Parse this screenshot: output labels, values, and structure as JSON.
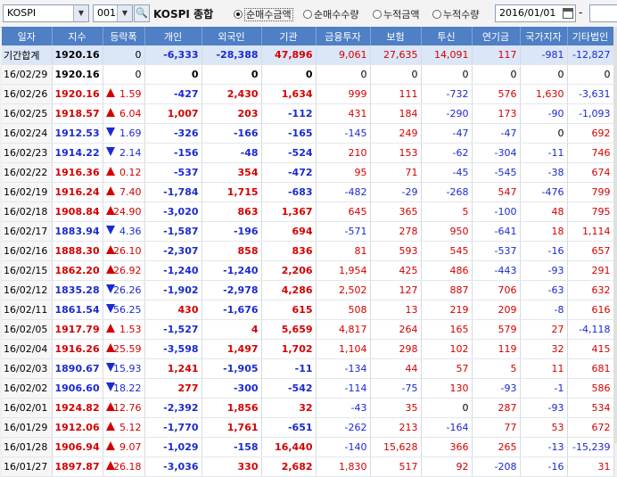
{
  "toolbar": {
    "market": "KOSPI",
    "code": "001",
    "title": "KOSPI 종합",
    "radios": [
      "순매수금액",
      "순매수수량",
      "누적금액",
      "누적수량"
    ],
    "start_date": "2016/01/01",
    "dash": "-"
  },
  "columns": [
    "일자",
    "지수",
    "등락폭",
    "개인",
    "외국인",
    "기관",
    "금융투자",
    "보험",
    "투신",
    "연기금",
    "국가지자",
    "기타법인"
  ],
  "rows": [
    [
      "기간합계",
      "1920.16",
      "0",
      "-6,333",
      "-28,388",
      "47,896",
      "9,061",
      "27,635",
      "14,091",
      "117",
      "-981",
      "-12,827"
    ],
    [
      "16/02/29",
      "1920.16",
      "0",
      "0",
      "0",
      "0",
      "0",
      "0",
      "0",
      "0",
      "0",
      "0"
    ],
    [
      "16/02/26",
      "1920.16",
      "1.59",
      "-427",
      "2,430",
      "1,634",
      "999",
      "111",
      "-732",
      "576",
      "1,630",
      "-3,631"
    ],
    [
      "16/02/25",
      "1918.57",
      "6.04",
      "1,007",
      "203",
      "-112",
      "431",
      "184",
      "-290",
      "173",
      "-90",
      "-1,093"
    ],
    [
      "16/02/24",
      "1912.53",
      "1.69",
      "-326",
      "-166",
      "-165",
      "-145",
      "249",
      "-47",
      "-47",
      "0",
      "692"
    ],
    [
      "16/02/23",
      "1914.22",
      "2.14",
      "-156",
      "-48",
      "-524",
      "210",
      "153",
      "-62",
      "-304",
      "-11",
      "746"
    ],
    [
      "16/02/22",
      "1916.36",
      "0.12",
      "-537",
      "354",
      "-472",
      "95",
      "71",
      "-45",
      "-545",
      "-38",
      "674"
    ],
    [
      "16/02/19",
      "1916.24",
      "7.40",
      "-1,784",
      "1,715",
      "-683",
      "-482",
      "-29",
      "-268",
      "547",
      "-476",
      "799"
    ],
    [
      "16/02/18",
      "1908.84",
      "24.90",
      "-3,020",
      "863",
      "1,367",
      "645",
      "365",
      "5",
      "-100",
      "48",
      "795"
    ],
    [
      "16/02/17",
      "1883.94",
      "4.36",
      "-1,587",
      "-196",
      "694",
      "-571",
      "278",
      "950",
      "-641",
      "18",
      "1,114"
    ],
    [
      "16/02/16",
      "1888.30",
      "26.10",
      "-2,307",
      "858",
      "836",
      "81",
      "593",
      "545",
      "-537",
      "-16",
      "657"
    ],
    [
      "16/02/15",
      "1862.20",
      "26.92",
      "-1,240",
      "-1,240",
      "2,206",
      "1,954",
      "425",
      "486",
      "-443",
      "-93",
      "291"
    ],
    [
      "16/02/12",
      "1835.28",
      "26.26",
      "-1,902",
      "-2,978",
      "4,286",
      "2,502",
      "127",
      "887",
      "706",
      "-63",
      "632"
    ],
    [
      "16/02/11",
      "1861.54",
      "56.25",
      "430",
      "-1,676",
      "615",
      "508",
      "13",
      "219",
      "209",
      "-8",
      "616"
    ],
    [
      "16/02/05",
      "1917.79",
      "1.53",
      "-1,527",
      "4",
      "5,659",
      "4,817",
      "264",
      "165",
      "579",
      "27",
      "-4,118"
    ],
    [
      "16/02/04",
      "1916.26",
      "25.59",
      "-3,598",
      "1,497",
      "1,702",
      "1,104",
      "298",
      "102",
      "119",
      "32",
      "415"
    ],
    [
      "16/02/03",
      "1890.67",
      "15.93",
      "1,241",
      "-1,905",
      "-11",
      "-134",
      "44",
      "57",
      "5",
      "11",
      "681"
    ],
    [
      "16/02/02",
      "1906.60",
      "18.22",
      "277",
      "-300",
      "-542",
      "-114",
      "-75",
      "130",
      "-93",
      "-1",
      "586"
    ],
    [
      "16/02/01",
      "1924.82",
      "12.76",
      "-2,392",
      "1,856",
      "32",
      "-43",
      "35",
      "0",
      "287",
      "-93",
      "534"
    ],
    [
      "16/01/29",
      "1912.06",
      "5.12",
      "-1,770",
      "1,761",
      "-651",
      "-262",
      "213",
      "-164",
      "77",
      "53",
      "672"
    ],
    [
      "16/01/28",
      "1906.94",
      "9.07",
      "-1,029",
      "-158",
      "16,440",
      "-140",
      "15,628",
      "366",
      "265",
      "-13",
      "-15,239"
    ],
    [
      "16/01/27",
      "1897.87",
      "26.18",
      "-3,036",
      "330",
      "2,682",
      "1,830",
      "517",
      "92",
      "-208",
      "-16",
      "31"
    ]
  ],
  "directions": [
    "",
    "",
    "up",
    "up",
    "down",
    "down",
    "up",
    "up",
    "up",
    "down",
    "up",
    "up",
    "down",
    "down",
    "up",
    "up",
    "down",
    "down",
    "up",
    "up",
    "up",
    "up"
  ],
  "colors": {
    "header_bg": "#4f7fc5",
    "up": "#d40000",
    "down": "#1a2ad0",
    "summary_bg": "#dbe6f7"
  }
}
